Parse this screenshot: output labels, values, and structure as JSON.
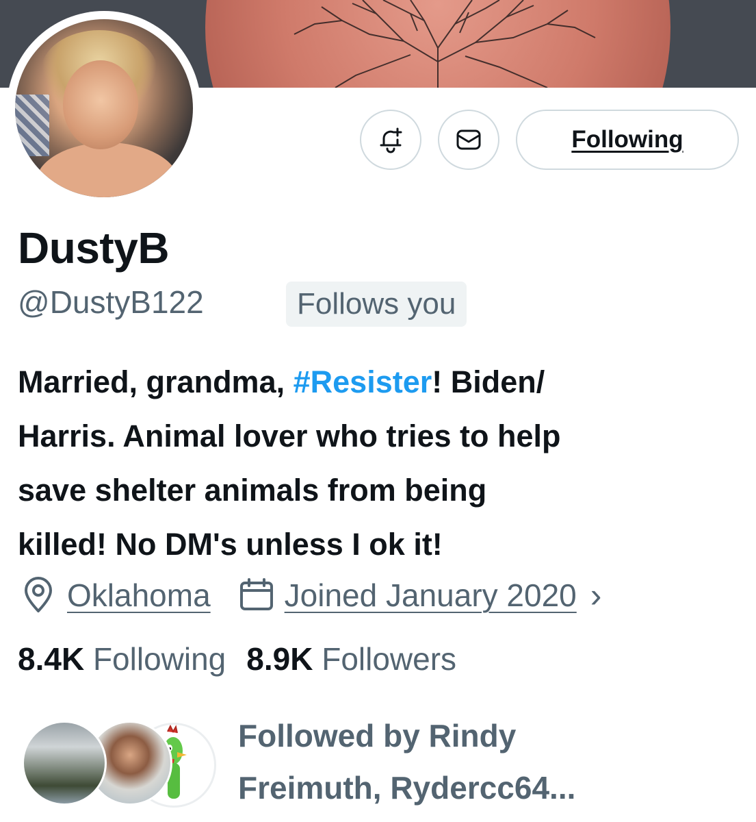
{
  "header": {
    "follow_button_label": "Following"
  },
  "profile": {
    "display_name": "DustyB",
    "handle": "@DustyB122",
    "follows_you_badge": "Follows you",
    "bio": {
      "line1_before": "Married, grandma, ",
      "line1_hashtag": "#Resister",
      "line1_after": "! Biden/",
      "line2": "Harris. Animal lover who tries to help",
      "line3": "save shelter animals from being",
      "line4": "killed! No DM's unless I ok it!"
    },
    "location": "Oklahoma",
    "joined": "Joined January 2020",
    "following_count": "8.4K",
    "following_label": "Following",
    "followers_count": "8.9K",
    "followers_label": "Followers",
    "followed_by_line1": "Followed by Rindy",
    "followed_by_line2": "Freimuth, Rydercc64..."
  },
  "icons": {
    "notify": "bell-plus-icon",
    "message": "envelope-icon",
    "location": "map-pin-icon",
    "joined": "calendar-icon",
    "more": "chevron-right-icon"
  },
  "colors": {
    "accent": "#1d9bf0",
    "secondary_text": "#536471",
    "primary_text": "#0f1419",
    "border": "#cfd9de"
  }
}
